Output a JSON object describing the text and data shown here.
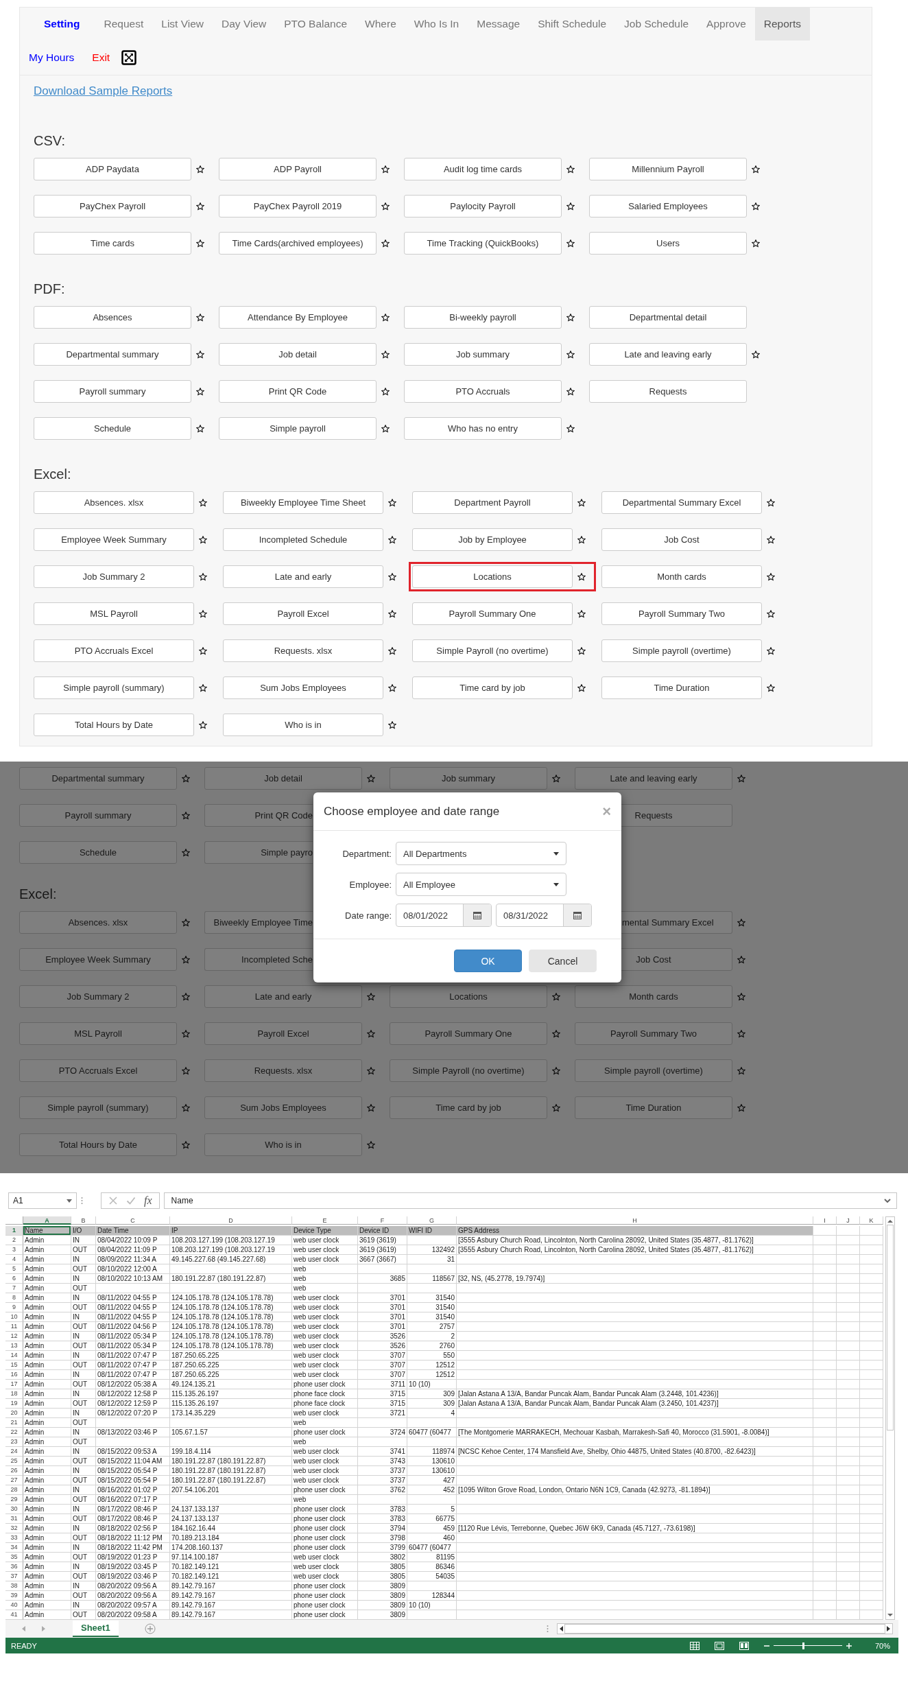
{
  "nav": {
    "row_1": [
      {
        "label": "Setting",
        "kind": "home",
        "selected": false
      },
      {
        "label": "Request",
        "kind": "item",
        "selected": false
      },
      {
        "label": "List View",
        "kind": "item",
        "selected": false
      },
      {
        "label": "Day View",
        "kind": "item",
        "selected": false
      },
      {
        "label": "PTO Balance",
        "kind": "item",
        "selected": false
      },
      {
        "label": "Where",
        "kind": "item",
        "selected": false
      },
      {
        "label": "Who Is In",
        "kind": "item",
        "selected": false
      },
      {
        "label": "Message",
        "kind": "item",
        "selected": false
      },
      {
        "label": "Shift Schedule",
        "kind": "item",
        "selected": false
      },
      {
        "label": "Job Schedule",
        "kind": "item",
        "selected": false
      },
      {
        "label": "Approve",
        "kind": "item",
        "selected": false
      },
      {
        "label": "Reports",
        "kind": "item",
        "selected": true
      }
    ],
    "row_2": [
      {
        "label": "My Hours",
        "kind": "link"
      },
      {
        "label": "Exit",
        "kind": "danger"
      },
      {
        "kind": "fullscreen_icon"
      }
    ]
  },
  "reports": {
    "download_link": "Download Sample Reports",
    "sections": [
      {
        "heading": "CSV:",
        "kind": "csv",
        "items": [
          {
            "label": "ADP Paydata",
            "star": true
          },
          {
            "label": "ADP Payroll",
            "star": true
          },
          {
            "label": "Audit log time cards",
            "star": true
          },
          {
            "label": "Millennium Payroll",
            "star": true
          },
          {
            "label": "PayChex Payroll",
            "star": true
          },
          {
            "label": "PayChex Payroll 2019",
            "star": true
          },
          {
            "label": "Paylocity Payroll",
            "star": true
          },
          {
            "label": "Salaried Employees",
            "star": true
          },
          {
            "label": "Time cards",
            "star": true
          },
          {
            "label": "Time Cards(archived employees)",
            "star": true
          },
          {
            "label": "Time Tracking (QuickBooks)",
            "star": true
          },
          {
            "label": "Users",
            "star": true
          }
        ]
      },
      {
        "heading": "PDF:",
        "kind": "pdf",
        "items": [
          {
            "label": "Absences",
            "star": true
          },
          {
            "label": "Attendance By Employee",
            "star": true
          },
          {
            "label": "Bi-weekly payroll",
            "star": true
          },
          {
            "label": "Departmental detail",
            "star": false
          },
          {
            "label": "Departmental summary",
            "star": true
          },
          {
            "label": "Job detail",
            "star": true
          },
          {
            "label": "Job summary",
            "star": true
          },
          {
            "label": "Late and leaving early",
            "star": true
          },
          {
            "label": "Payroll summary",
            "star": true
          },
          {
            "label": "Print QR Code",
            "star": true
          },
          {
            "label": "PTO Accruals",
            "star": true
          },
          {
            "label": "Requests",
            "star": false
          },
          {
            "label": "Schedule",
            "star": true
          },
          {
            "label": "Simple payroll",
            "star": true
          },
          {
            "label": "Who has no entry",
            "star": true
          }
        ]
      },
      {
        "heading": "Excel:",
        "kind": "excel",
        "items": [
          {
            "label": "Absences. xlsx",
            "star": true,
            "highlighted": false
          },
          {
            "label": "Biweekly Employee Time Sheet",
            "star": true,
            "highlighted": false
          },
          {
            "label": "Department Payroll",
            "star": true,
            "highlighted": false
          },
          {
            "label": "Departmental Summary Excel",
            "star": true,
            "highlighted": false
          },
          {
            "label": "Employee Week Summary",
            "star": true,
            "highlighted": false
          },
          {
            "label": "Incompleted Schedule",
            "star": true,
            "highlighted": false
          },
          {
            "label": "Job by Employee",
            "star": true,
            "highlighted": false
          },
          {
            "label": "Job Cost",
            "star": true,
            "highlighted": false
          },
          {
            "label": "Job Summary 2",
            "star": true,
            "highlighted": false
          },
          {
            "label": "Late and early",
            "star": true,
            "highlighted": false
          },
          {
            "label": "Locations",
            "star": true,
            "highlighted": true
          },
          {
            "label": "Month cards",
            "star": true,
            "highlighted": false
          },
          {
            "label": "MSL Payroll",
            "star": true,
            "highlighted": false
          },
          {
            "label": "Payroll Excel",
            "star": true,
            "highlighted": false
          },
          {
            "label": "Payroll Summary One",
            "star": true,
            "highlighted": false
          },
          {
            "label": "Payroll Summary Two",
            "star": true,
            "highlighted": false
          },
          {
            "label": "PTO Accruals Excel",
            "star": true,
            "highlighted": false
          },
          {
            "label": "Requests. xlsx",
            "star": true,
            "highlighted": false
          },
          {
            "label": "Simple Payroll (no overtime)",
            "star": true,
            "highlighted": false
          },
          {
            "label": "Simple payroll (overtime)",
            "star": true,
            "highlighted": false
          },
          {
            "label": "Simple payroll (summary)",
            "star": true,
            "highlighted": false
          },
          {
            "label": "Sum Jobs Employees",
            "star": true,
            "highlighted": false
          },
          {
            "label": "Time card by job",
            "star": true,
            "highlighted": false
          },
          {
            "label": "Time Duration",
            "star": true,
            "highlighted": false
          },
          {
            "label": "Total Hours by Date",
            "star": true,
            "highlighted": false
          },
          {
            "label": "Who is in",
            "star": true,
            "highlighted": false
          }
        ]
      }
    ]
  },
  "backdrop": {
    "rows": [
      {
        "kind": "buttons",
        "cells": [
          {
            "label": "Departmental summary",
            "kind": "full",
            "star": true
          },
          {
            "label": "Job detail",
            "kind": "full",
            "star": true
          },
          {
            "label": "Job summary",
            "kind": "full",
            "star": true
          },
          {
            "label": "Late and leaving early",
            "kind": "full",
            "star": true
          }
        ]
      },
      {
        "kind": "buttons",
        "cells": [
          {
            "label": "Payroll summary",
            "kind": "full",
            "star": true
          },
          {
            "label": "Print QR Code",
            "kind": "cut_right",
            "star": false
          },
          {
            "kind": "covered"
          },
          {
            "label": "Requests",
            "kind": "full",
            "star": false
          }
        ]
      },
      {
        "kind": "buttons",
        "cells": [
          {
            "label": "Schedule",
            "kind": "full",
            "star": true
          },
          {
            "label": "Simple payro",
            "kind": "cut_right",
            "star": false
          },
          {
            "kind": "covered"
          }
        ]
      },
      {
        "kind": "heading",
        "label": "Excel:"
      },
      {
        "kind": "buttons",
        "cells": [
          {
            "label": "Absences. xlsx",
            "kind": "full",
            "star": true
          },
          {
            "label": "Biweekly Employee Time",
            "kind": "cut_right",
            "star": false
          },
          {
            "kind": "covered"
          },
          {
            "label": "mental Summary Excel",
            "kind": "cut_left",
            "star": true
          }
        ]
      },
      {
        "kind": "buttons",
        "cells": [
          {
            "label": "Employee Week Summary",
            "kind": "full",
            "star": true
          },
          {
            "label": "Incompleted Sche",
            "kind": "cut_right",
            "star": false
          },
          {
            "kind": "covered"
          },
          {
            "label": "Job Cost",
            "kind": "full",
            "star": true
          }
        ]
      },
      {
        "kind": "buttons",
        "cells": [
          {
            "label": "Job Summary 2",
            "kind": "full",
            "star": true
          },
          {
            "label": "Late and early",
            "kind": "full",
            "star": true
          },
          {
            "label": "Locations",
            "kind": "full",
            "star": true
          },
          {
            "label": "Month cards",
            "kind": "full",
            "star": true
          }
        ]
      },
      {
        "kind": "buttons",
        "cells": [
          {
            "label": "MSL Payroll",
            "kind": "full",
            "star": true
          },
          {
            "label": "Payroll Excel",
            "kind": "full",
            "star": true
          },
          {
            "label": "Payroll Summary One",
            "kind": "full",
            "star": true
          },
          {
            "label": "Payroll Summary Two",
            "kind": "full",
            "star": true
          }
        ]
      },
      {
        "kind": "buttons",
        "cells": [
          {
            "label": "PTO Accruals Excel",
            "kind": "full",
            "star": true
          },
          {
            "label": "Requests. xlsx",
            "kind": "full",
            "star": true
          },
          {
            "label": "Simple Payroll (no overtime)",
            "kind": "full",
            "star": true
          },
          {
            "label": "Simple payroll (overtime)",
            "kind": "full",
            "star": true
          }
        ]
      },
      {
        "kind": "buttons",
        "cells": [
          {
            "label": "Simple payroll (summary)",
            "kind": "full",
            "star": true
          },
          {
            "label": "Sum Jobs Employees",
            "kind": "full",
            "star": true
          },
          {
            "label": "Time card by job",
            "kind": "full",
            "star": true
          },
          {
            "label": "Time Duration",
            "kind": "full",
            "star": true
          }
        ]
      },
      {
        "kind": "buttons",
        "cells": [
          {
            "label": "Total Hours by Date",
            "kind": "full",
            "star": true
          },
          {
            "label": "Who is in",
            "kind": "full",
            "star": true
          }
        ]
      }
    ],
    "modal": {
      "title": "Choose employee and date range",
      "close": "×",
      "fields": [
        {
          "label": "Department:",
          "kind": "select",
          "value": "All Departments"
        },
        {
          "label": "Employee:",
          "kind": "select",
          "value": "All Employee"
        },
        {
          "label": "Date range:",
          "kind": "date_range",
          "values": [
            "08/01/2022",
            "08/31/2022"
          ]
        }
      ],
      "buttons": [
        {
          "label": "OK",
          "kind": "primary"
        },
        {
          "label": "Cancel",
          "kind": "default"
        }
      ]
    }
  },
  "spreadsheet": {
    "name_box": "A1",
    "fx": "fx",
    "formula": "Name",
    "columns": [
      {
        "label": "A",
        "selected": true
      },
      {
        "label": "B",
        "selected": false
      },
      {
        "label": "C",
        "selected": false
      },
      {
        "label": "D",
        "selected": false
      },
      {
        "label": "E",
        "selected": false
      },
      {
        "label": "F",
        "selected": false
      },
      {
        "label": "G",
        "selected": false
      },
      {
        "label": "H",
        "selected": false
      },
      {
        "label": "I",
        "selected": false
      },
      {
        "label": "J",
        "selected": false
      },
      {
        "label": "K",
        "selected": false
      }
    ],
    "rows": [
      {
        "number": "1",
        "selected": true,
        "kind": "header",
        "cells": [
          "Name",
          "I/O",
          "Date Time",
          "IP",
          "Device Type",
          "Device ID",
          "WIFI ID",
          "GPS Address"
        ]
      },
      {
        "number": "2",
        "selected": false,
        "kind": "data",
        "cells": [
          "Admin",
          "IN",
          "08/04/2022 10:09 P",
          "108.203.127.199 (108.203.127.19",
          "web user clock",
          "3619 (3619)",
          null,
          "[3555 Asbury Church Road, Lincolnton, North Carolina 28092, United States (35.4877, -81.1762)]"
        ]
      },
      {
        "number": "3",
        "selected": false,
        "kind": "data",
        "cells": [
          "Admin",
          "OUT",
          "08/04/2022 11:09 P",
          "108.203.127.199 (108.203.127.19",
          "web user clock",
          "3619 (3619)",
          "132492",
          "[3555 Asbury Church Road, Lincolnton, North Carolina 28092, United States (35.4877, -81.1762)]"
        ]
      },
      {
        "number": "4",
        "selected": false,
        "kind": "data",
        "cells": [
          "Admin",
          "IN",
          "08/09/2022 11:34 A",
          "49.145.227.68 (49.145.227.68)",
          "web user clock",
          "3667 (3667)",
          "31",
          null
        ]
      },
      {
        "number": "5",
        "selected": false,
        "kind": "data",
        "cells": [
          "Admin",
          "OUT",
          "08/10/2022 12:00 A",
          null,
          "web",
          null,
          null,
          null
        ]
      },
      {
        "number": "6",
        "selected": false,
        "kind": "data",
        "cells": [
          "Admin",
          "IN",
          "08/10/2022 10:13 AM",
          "180.191.22.87 (180.191.22.87)",
          "web",
          "3685",
          "118567",
          "[32, NS,  (45.2778, 19.7974)]"
        ]
      },
      {
        "number": "7",
        "selected": false,
        "kind": "data",
        "cells": [
          "Admin",
          "OUT",
          null,
          null,
          "web",
          null,
          null,
          null
        ]
      },
      {
        "number": "8",
        "selected": false,
        "kind": "data",
        "cells": [
          "Admin",
          "IN",
          "08/11/2022 04:55 P",
          "124.105.178.78 (124.105.178.78)",
          "web user clock",
          "3701",
          "31540",
          null
        ]
      },
      {
        "number": "9",
        "selected": false,
        "kind": "data",
        "cells": [
          "Admin",
          "OUT",
          "08/11/2022 04:55 P",
          "124.105.178.78 (124.105.178.78)",
          "web user clock",
          "3701",
          "31540",
          null
        ]
      },
      {
        "number": "10",
        "selected": false,
        "kind": "data",
        "cells": [
          "Admin",
          "IN",
          "08/11/2022 04:55 P",
          "124.105.178.78 (124.105.178.78)",
          "web user clock",
          "3701",
          "31540",
          null
        ]
      },
      {
        "number": "11",
        "selected": false,
        "kind": "data",
        "cells": [
          "Admin",
          "OUT",
          "08/11/2022 04:56 P",
          "124.105.178.78 (124.105.178.78)",
          "web user clock",
          "3701",
          "2757",
          null
        ]
      },
      {
        "number": "12",
        "selected": false,
        "kind": "data",
        "cells": [
          "Admin",
          "IN",
          "08/11/2022 05:34 P",
          "124.105.178.78 (124.105.178.78)",
          "web user clock",
          "3526",
          "2",
          null
        ]
      },
      {
        "number": "13",
        "selected": false,
        "kind": "data",
        "cells": [
          "Admin",
          "OUT",
          "08/11/2022 05:34 P",
          "124.105.178.78 (124.105.178.78)",
          "web user clock",
          "3526",
          "2760",
          null
        ]
      },
      {
        "number": "14",
        "selected": false,
        "kind": "data",
        "cells": [
          "Admin",
          "IN",
          "08/11/2022 07:47 P",
          "187.250.65.225",
          "web user clock",
          "3707",
          "550",
          null
        ]
      },
      {
        "number": "15",
        "selected": false,
        "kind": "data",
        "cells": [
          "Admin",
          "OUT",
          "08/11/2022 07:47 P",
          "187.250.65.225",
          "web user clock",
          "3707",
          "12512",
          null
        ]
      },
      {
        "number": "16",
        "selected": false,
        "kind": "data",
        "cells": [
          "Admin",
          "IN",
          "08/11/2022 07:47 P",
          "187.250.65.225",
          "web user clock",
          "3707",
          "12512",
          null
        ]
      },
      {
        "number": "17",
        "selected": false,
        "kind": "data",
        "cells": [
          "Admin",
          "OUT",
          "08/12/2022 05:38 A",
          "49.124.135.21",
          "phone user clock",
          "3711",
          "10 (10)",
          null
        ]
      },
      {
        "number": "18",
        "selected": false,
        "kind": "data",
        "cells": [
          "Admin",
          "IN",
          "08/12/2022 12:58 P",
          "115.135.26.197",
          "phone face clock",
          "3715",
          "309",
          "[Jalan Astana A 13/A, Bandar Puncak Alam, Bandar Puncak Alam (3.2448, 101.4236)]"
        ]
      },
      {
        "number": "19",
        "selected": false,
        "kind": "data",
        "cells": [
          "Admin",
          "OUT",
          "08/12/2022 12:59 P",
          "115.135.26.197",
          "phone face clock",
          "3715",
          "309",
          "[Jalan Astana A 13/A, Bandar Puncak Alam, Bandar Puncak Alam (3.2450, 101.4237)]"
        ]
      },
      {
        "number": "20",
        "selected": false,
        "kind": "data",
        "cells": [
          "Admin",
          "IN",
          "08/12/2022 07:20 P",
          "173.14.35.229",
          "web user clock",
          "3721",
          "4",
          null
        ]
      },
      {
        "number": "21",
        "selected": false,
        "kind": "data",
        "cells": [
          "Admin",
          "OUT",
          null,
          null,
          "web",
          null,
          null,
          null
        ]
      },
      {
        "number": "22",
        "selected": false,
        "kind": "data",
        "cells": [
          "Admin",
          "IN",
          "08/13/2022 03:46 P",
          "105.67.1.57",
          "phone user clock",
          "3724",
          "60477 (60477",
          "[The Montgomerie MARRAKECH, Mechouar Kasbah, Marrakesh-Safi 40, Morocco (31.5901, -8.0084)]"
        ]
      },
      {
        "number": "23",
        "selected": false,
        "kind": "data",
        "cells": [
          "Admin",
          "OUT",
          null,
          null,
          "web",
          null,
          null,
          null
        ]
      },
      {
        "number": "24",
        "selected": false,
        "kind": "data",
        "cells": [
          "Admin",
          "IN",
          "08/15/2022 09:53 A",
          "199.18.4.114",
          "web user clock",
          "3741",
          "118974",
          "[NCSC Kehoe Center, 174 Mansfield Ave, Shelby, Ohio 44875, United States (40.8700, -82.6423)]"
        ]
      },
      {
        "number": "25",
        "selected": false,
        "kind": "data",
        "cells": [
          "Admin",
          "OUT",
          "08/15/2022 11:04 AM",
          "180.191.22.87 (180.191.22.87)",
          "web user clock",
          "3743",
          "130610",
          null
        ]
      },
      {
        "number": "26",
        "selected": false,
        "kind": "data",
        "cells": [
          "Admin",
          "IN",
          "08/15/2022 05:54 P",
          "180.191.22.87 (180.191.22.87)",
          "web user clock",
          "3737",
          "130610",
          null
        ]
      },
      {
        "number": "27",
        "selected": false,
        "kind": "data",
        "cells": [
          "Admin",
          "OUT",
          "08/15/2022 05:54 P",
          "180.191.22.87 (180.191.22.87)",
          "web user clock",
          "3737",
          "427",
          null
        ]
      },
      {
        "number": "28",
        "selected": false,
        "kind": "data",
        "cells": [
          "Admin",
          "IN",
          "08/16/2022 01:02 P",
          "207.54.106.201",
          "phone user clock",
          "3762",
          "452",
          "[1095 Wilton Grove Road, London, Ontario N6N 1C9, Canada (42.9273, -81.1894)]"
        ]
      },
      {
        "number": "29",
        "selected": false,
        "kind": "data",
        "cells": [
          "Admin",
          "OUT",
          "08/16/2022 07:17 P",
          null,
          "web",
          null,
          null,
          null
        ]
      },
      {
        "number": "30",
        "selected": false,
        "kind": "data",
        "cells": [
          "Admin",
          "IN",
          "08/17/2022 08:46 P",
          "24.137.133.137",
          "phone user clock",
          "3783",
          "5",
          null
        ]
      },
      {
        "number": "31",
        "selected": false,
        "kind": "data",
        "cells": [
          "Admin",
          "OUT",
          "08/17/2022 08:46 P",
          "24.137.133.137",
          "phone user clock",
          "3783",
          "66775",
          null
        ]
      },
      {
        "number": "32",
        "selected": false,
        "kind": "data",
        "cells": [
          "Admin",
          "IN",
          "08/18/2022 02:56 P",
          "184.162.16.44",
          "phone user clock",
          "3794",
          "459",
          "[1120 Rue Lévis, Terrebonne, Quebec J6W 6K9, Canada (45.7127, -73.6198)]"
        ]
      },
      {
        "number": "33",
        "selected": false,
        "kind": "data",
        "cells": [
          "Admin",
          "OUT",
          "08/18/2022 11:12 PM",
          "70.189.213.184",
          "phone user clock",
          "3798",
          "460",
          null
        ]
      },
      {
        "number": "34",
        "selected": false,
        "kind": "data",
        "cells": [
          "Admin",
          "IN",
          "08/18/2022 11:42 PM",
          "174.208.160.137",
          "phone user clock",
          "3799",
          "60477 (60477",
          null
        ]
      },
      {
        "number": "35",
        "selected": false,
        "kind": "data",
        "cells": [
          "Admin",
          "OUT",
          "08/19/2022 01:23 P",
          "97.114.100.187",
          "web user clock",
          "3802",
          "81195",
          null
        ]
      },
      {
        "number": "36",
        "selected": false,
        "kind": "data",
        "cells": [
          "Admin",
          "IN",
          "08/19/2022 03:45 P",
          "70.182.149.121",
          "web user clock",
          "3805",
          "86346",
          null
        ]
      },
      {
        "number": "37",
        "selected": false,
        "kind": "data",
        "cells": [
          "Admin",
          "OUT",
          "08/19/2022 03:46 P",
          "70.182.149.121",
          "web user clock",
          "3805",
          "54035",
          null
        ]
      },
      {
        "number": "38",
        "selected": false,
        "kind": "data",
        "cells": [
          "Admin",
          "IN",
          "08/20/2022 09:56 A",
          "89.142.79.167",
          "phone user clock",
          "3809",
          null,
          null
        ]
      },
      {
        "number": "39",
        "selected": false,
        "kind": "data",
        "cells": [
          "Admin",
          "OUT",
          "08/20/2022 09:56 A",
          "89.142.79.167",
          "phone user clock",
          "3809",
          "128344",
          null
        ]
      },
      {
        "number": "40",
        "selected": false,
        "kind": "data",
        "cells": [
          "Admin",
          "IN",
          "08/20/2022 09:57 A",
          "89.142.79.167",
          "phone user clock",
          "3809",
          "10 (10)",
          null
        ]
      },
      {
        "number": "41",
        "selected": false,
        "kind": "data",
        "cells": [
          "Admin",
          "OUT",
          "08/20/2022 09:58 A",
          "89.142.79.167",
          "phone user clock",
          "3809",
          null,
          null
        ]
      }
    ],
    "sheet_tabs": [
      {
        "label": "Sheet1",
        "selected": true
      }
    ],
    "status": "READY",
    "zoom": {
      "level": 0.42,
      "reading": "70%"
    }
  }
}
